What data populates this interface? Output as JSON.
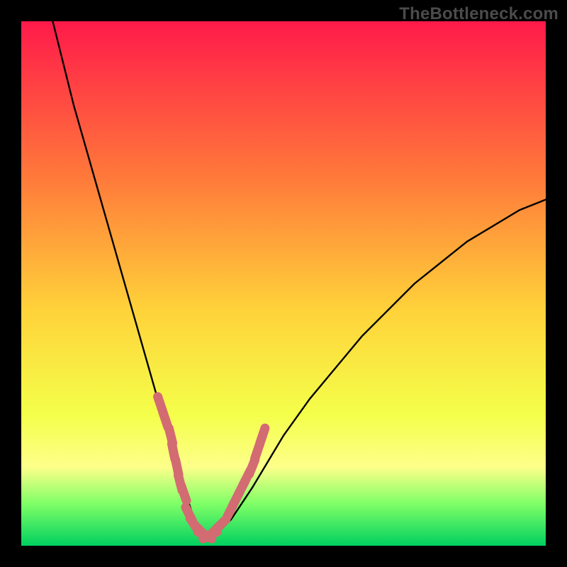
{
  "watermark": "TheBottleneck.com",
  "colors": {
    "background": "#000000",
    "gradient_top": "#ff1a4a",
    "gradient_mid_upper": "#ff7a3a",
    "gradient_mid": "#ffd23a",
    "gradient_mid_lower": "#f4ff4a",
    "gradient_band_yellow": "#fdff8a",
    "gradient_lower_green": "#7fff66",
    "gradient_green": "#00d060",
    "curve": "#000000",
    "marker": "#d36b72"
  },
  "chart_data": {
    "type": "line",
    "title": "",
    "xlabel": "",
    "ylabel": "",
    "xlim": [
      0,
      100
    ],
    "ylim": [
      0,
      100
    ],
    "grid": false,
    "legend": false,
    "series": [
      {
        "name": "bottleneck-curve",
        "x": [
          6,
          8,
          10,
          12,
          14,
          16,
          18,
          20,
          22,
          24,
          26,
          28,
          30,
          31,
          32,
          33,
          34,
          35,
          36,
          38,
          40,
          42,
          44,
          47,
          50,
          55,
          60,
          65,
          70,
          75,
          80,
          85,
          90,
          95,
          100
        ],
        "y": [
          100,
          92,
          84,
          77,
          70,
          63,
          56,
          49,
          42,
          35,
          28,
          22,
          15,
          11,
          8,
          5,
          3,
          2,
          2,
          3,
          5,
          8,
          11,
          16,
          21,
          28,
          34,
          40,
          45,
          50,
          54,
          58,
          61,
          64,
          66
        ]
      }
    ],
    "markers": [
      {
        "name": "left-cluster",
        "x": [
          26.5,
          27.5,
          28.5,
          29.0,
          29.7,
          30.3,
          31.0
        ],
        "y": [
          27,
          24,
          21,
          18,
          15,
          12,
          10
        ]
      },
      {
        "name": "bottom-cluster",
        "x": [
          32.0,
          33.0,
          34.0,
          35.0,
          36.0,
          37.0,
          38.0
        ],
        "y": [
          6,
          4,
          3,
          2,
          2,
          3,
          4
        ]
      },
      {
        "name": "right-cluster",
        "x": [
          40.0,
          41.0,
          42.0,
          43.0,
          44.0,
          45.0,
          46.0
        ],
        "y": [
          7,
          9,
          11,
          13,
          15,
          18,
          21
        ]
      }
    ]
  }
}
